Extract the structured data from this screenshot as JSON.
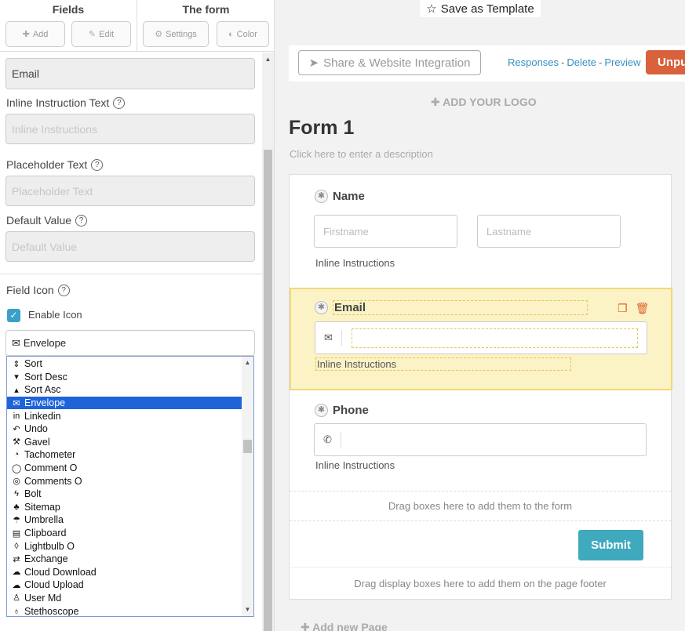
{
  "left_panel": {
    "groups": [
      {
        "title": "Fields",
        "buttons": [
          {
            "label": "Add",
            "icon": "plus-icon"
          },
          {
            "label": "Edit",
            "icon": "pencil-icon"
          }
        ]
      },
      {
        "title": "The form",
        "buttons": [
          {
            "label": "Settings",
            "icon": "gear-icon"
          },
          {
            "label": "Color",
            "icon": "palette-icon"
          }
        ]
      }
    ],
    "field_label_value": "Email",
    "inline_instruction": {
      "label": "Inline Instruction Text",
      "placeholder": "Inline Instructions"
    },
    "placeholder_text": {
      "label": "Placeholder Text",
      "placeholder": "Placeholder Text"
    },
    "default_value": {
      "label": "Default Value",
      "placeholder": "Default Value"
    },
    "field_icon": {
      "label": "Field Icon",
      "enable_label": "Enable Icon",
      "enabled": true,
      "selected": "Envelope",
      "options": [
        {
          "label": "Sort",
          "icon": "sort-icon"
        },
        {
          "label": "Sort Desc",
          "icon": "sort-desc-icon"
        },
        {
          "label": "Sort Asc",
          "icon": "sort-asc-icon"
        },
        {
          "label": "Envelope",
          "icon": "envelope-icon",
          "selected": true
        },
        {
          "label": "Linkedin",
          "icon": "linkedin-icon"
        },
        {
          "label": "Undo",
          "icon": "undo-icon"
        },
        {
          "label": "Gavel",
          "icon": "gavel-icon"
        },
        {
          "label": "Tachometer",
          "icon": "tachometer-icon"
        },
        {
          "label": "Comment O",
          "icon": "comment-icon"
        },
        {
          "label": "Comments O",
          "icon": "comments-icon"
        },
        {
          "label": "Bolt",
          "icon": "bolt-icon"
        },
        {
          "label": "Sitemap",
          "icon": "sitemap-icon"
        },
        {
          "label": "Umbrella",
          "icon": "umbrella-icon"
        },
        {
          "label": "Clipboard",
          "icon": "clipboard-icon"
        },
        {
          "label": "Lightbulb O",
          "icon": "lightbulb-icon"
        },
        {
          "label": "Exchange",
          "icon": "exchange-icon"
        },
        {
          "label": "Cloud Download",
          "icon": "cloud-download-icon"
        },
        {
          "label": "Cloud Upload",
          "icon": "cloud-upload-icon"
        },
        {
          "label": "User Md",
          "icon": "user-md-icon"
        },
        {
          "label": "Stethoscope",
          "icon": "stethoscope-icon"
        }
      ]
    }
  },
  "header": {
    "save_template": "Save as Template",
    "share_button": "Share & Website Integration",
    "links": [
      "Responses",
      "Delete",
      "Preview"
    ],
    "link_separator": "-",
    "unpublish": "Unpu"
  },
  "form": {
    "add_logo": "ADD YOUR LOGO",
    "title": "Form 1",
    "description": "Click here to enter a description",
    "fields": {
      "name": {
        "label": "Name",
        "first_placeholder": "Firstname",
        "last_placeholder": "Lastname",
        "instructions": "Inline Instructions"
      },
      "email": {
        "label": "Email",
        "instructions": "Inline Instructions"
      },
      "phone": {
        "label": "Phone",
        "instructions": "Inline Instructions"
      }
    },
    "drop_zone": "Drag boxes here to add them to the form",
    "submit": "Submit",
    "footer_zone": "Drag display boxes here to add them on the page footer",
    "add_page": "Add new Page"
  },
  "colors": {
    "accent": "#3fa9be",
    "unpublish": "#d9613c",
    "selected_field_bg": "#fbf3c6",
    "link": "#3a8fc4"
  }
}
